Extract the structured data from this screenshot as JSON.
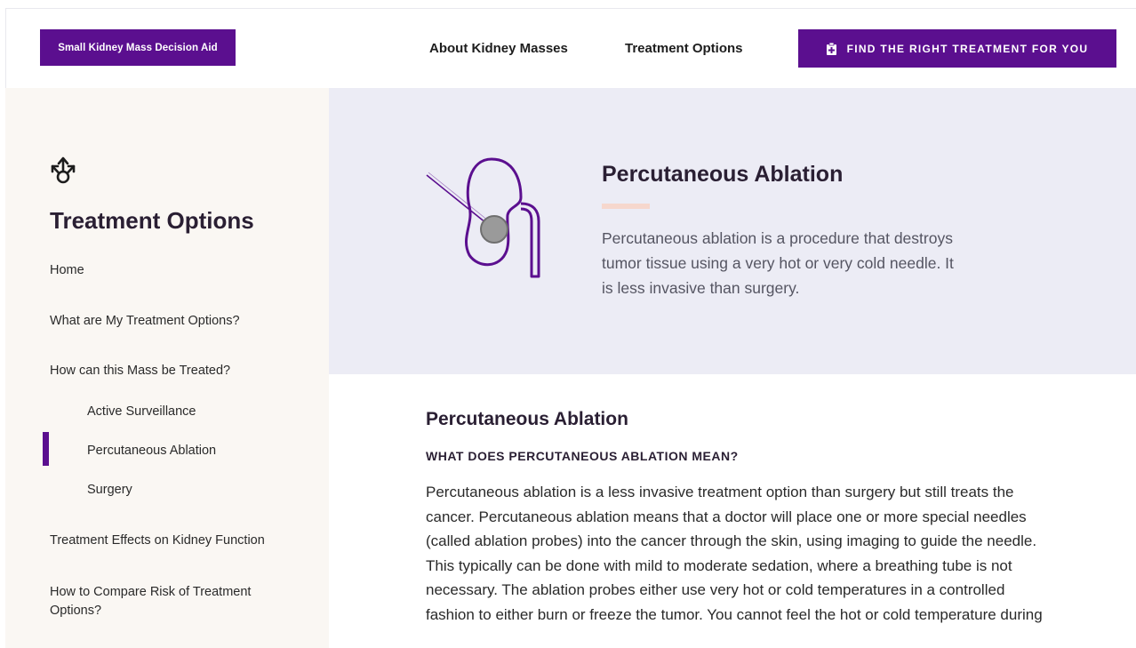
{
  "header": {
    "brand": "Small Kidney Mass Decision Aid",
    "nav": [
      "About Kidney Masses",
      "Treatment Options"
    ],
    "cta_label": "FIND THE RIGHT TREATMENT FOR YOU",
    "cta_icon": "clipboard-icon"
  },
  "sidebar": {
    "icon": "split-arrows-icon",
    "title": "Treatment Options",
    "items": [
      {
        "label": "Home"
      },
      {
        "label": "What are My Treatment Options?"
      },
      {
        "label": "How can this Mass be Treated?"
      },
      {
        "label": "Active Surveillance"
      },
      {
        "label": "Percutaneous Ablation"
      },
      {
        "label": "Surgery"
      },
      {
        "label": "Treatment Effects on Kidney Function"
      },
      {
        "label": "How to Compare Risk of Treatment Options?"
      }
    ],
    "active_item": "Percutaneous Ablation",
    "accent": "#5b0f8f"
  },
  "hero": {
    "illustration": "kidney-needle-icon",
    "title": "Percutaneous Ablation",
    "description": "Percutaneous ablation is a procedure that destroys tumor tissue using a very hot or very cold needle. It is less invasive than surgery."
  },
  "content": {
    "title": "Percutaneous Ablation",
    "subtitle": "WHAT DOES PERCUTANEOUS ABLATION MEAN?",
    "body": "Percutaneous ablation is a less invasive treatment option than surgery but still treats the cancer. Percutaneous ablation means that a doctor will place one or more special needles (called ablation probes) into the cancer through the skin, using imaging to guide the needle. This typically can be done with mild to moderate sedation, where a breathing tube is not necessary. The ablation probes either use very hot or cold temperatures in a controlled fashion to either burn or freeze the tumor. You cannot feel the hot or cold temperature during"
  },
  "colors": {
    "brand": "#5b0f8f",
    "sidebar_bg": "#faf7f3",
    "hero_bg": "#ececf5"
  }
}
